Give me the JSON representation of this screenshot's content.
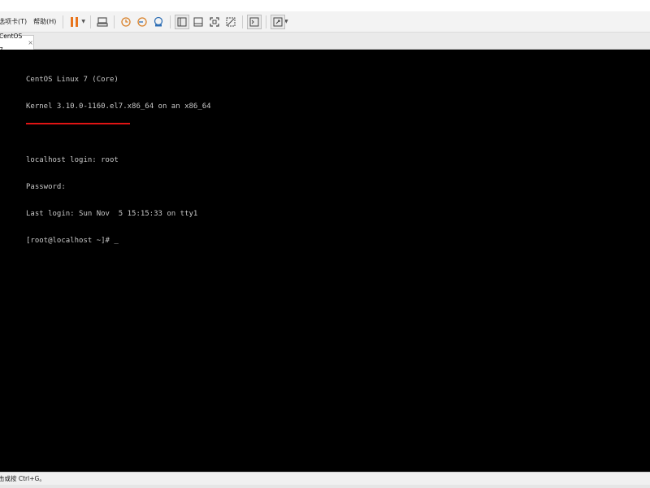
{
  "menu": {
    "tabs_label": "选项卡(T)",
    "help_label": "帮助(H)"
  },
  "toolbar": {
    "icons": [
      "pause-icon",
      "send-ctrl-alt-del-icon",
      "snapshot-icon",
      "revert-snapshot-icon",
      "snapshot-manager-icon",
      "normal-view-icon",
      "single-window-icon",
      "fullscreen-icon",
      "unity-icon",
      "console-view-icon",
      "stretch-view-icon"
    ],
    "accent_pause": "#e8741c"
  },
  "tab": {
    "label": "CentOS 7",
    "close": "×"
  },
  "terminal": {
    "lines": [
      "CentOS Linux 7 (Core)",
      "Kernel 3.10.0-1160.el7.x86_64 on an x86_64",
      "",
      "localhost login: root",
      "Password:",
      "Last login: Sun Nov  5 15:15:33 on tty1",
      "[root@localhost ~]# _"
    ],
    "text_color": "#c8c8c8",
    "background": "#000000",
    "highlight_color": "#e01414"
  },
  "status": {
    "text": "击或按 Ctrl+G。"
  }
}
